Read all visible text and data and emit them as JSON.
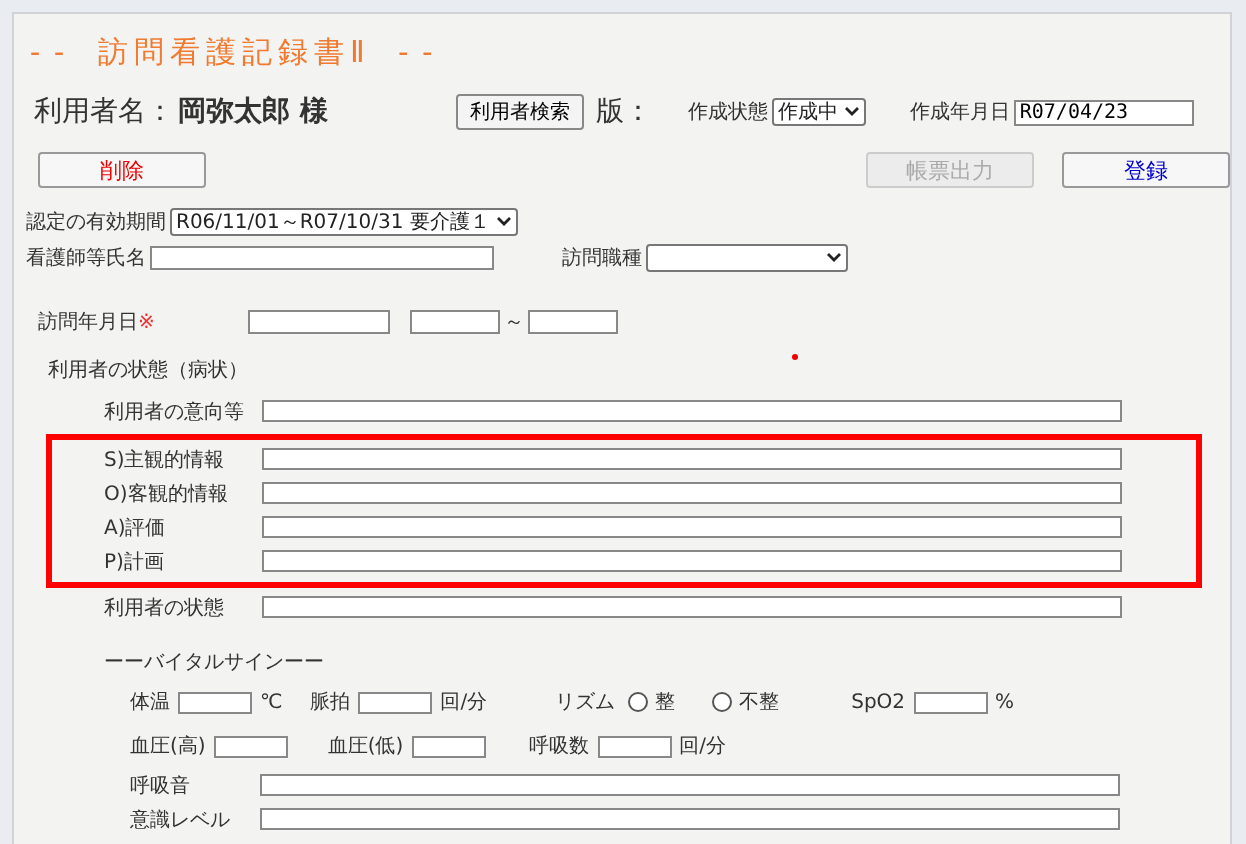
{
  "title": "-- 訪問看護記録書Ⅱ --",
  "user": {
    "label": "利用者名：",
    "name": "岡弥太郎 様"
  },
  "search_button": "利用者検索",
  "version_label": "版：",
  "status": {
    "label": "作成状態",
    "value": "作成中"
  },
  "created_date": {
    "label": "作成年月日",
    "value": "R07/04/23"
  },
  "delete_button": {
    "label": "削除",
    "disabled": false
  },
  "print_button": {
    "label": "帳票出力",
    "disabled": true
  },
  "register_button": {
    "label": "登録",
    "disabled": false
  },
  "certification": {
    "label": "認定の有効期間",
    "value": "R06/11/01～R07/10/31 要介護１"
  },
  "nurse_name": {
    "label": "看護師等氏名"
  },
  "visit_job": {
    "label": "訪問職種"
  },
  "visit_date": {
    "label": "訪問年月日",
    "required_mark": "※",
    "separator": "～"
  },
  "condition_heading": "利用者の状態（病状）",
  "text_rows": [
    {
      "label": "利用者の意向等",
      "highlighted": false
    },
    {
      "label": "S)主観的情報",
      "highlighted": true
    },
    {
      "label": "O)客観的情報",
      "highlighted": true
    },
    {
      "label": "A)評価",
      "highlighted": true
    },
    {
      "label": "P)計画",
      "highlighted": true
    },
    {
      "label": "利用者の状態",
      "highlighted": false
    }
  ],
  "vitals_heading": "ーーバイタルサインーー",
  "vital_rows": [
    [
      {
        "kind": "input",
        "label": "体温",
        "unit": "℃"
      },
      {
        "kind": "input",
        "label": "脈拍",
        "unit": "回/分"
      },
      {
        "kind": "radio",
        "label": "リズム",
        "options": [
          {
            "label": "整",
            "selected": false
          },
          {
            "label": "不整",
            "selected": false
          }
        ]
      },
      {
        "kind": "input",
        "label": "SpO2",
        "unit": "%"
      }
    ],
    [
      {
        "kind": "input",
        "label": "血圧(高)"
      },
      {
        "kind": "input",
        "label": "血圧(低)"
      },
      {
        "kind": "input",
        "label": "呼吸数",
        "unit": "回/分"
      }
    ]
  ],
  "vital_text_rows": [
    {
      "label": "呼吸音"
    },
    {
      "label": "意識レベル"
    }
  ]
}
